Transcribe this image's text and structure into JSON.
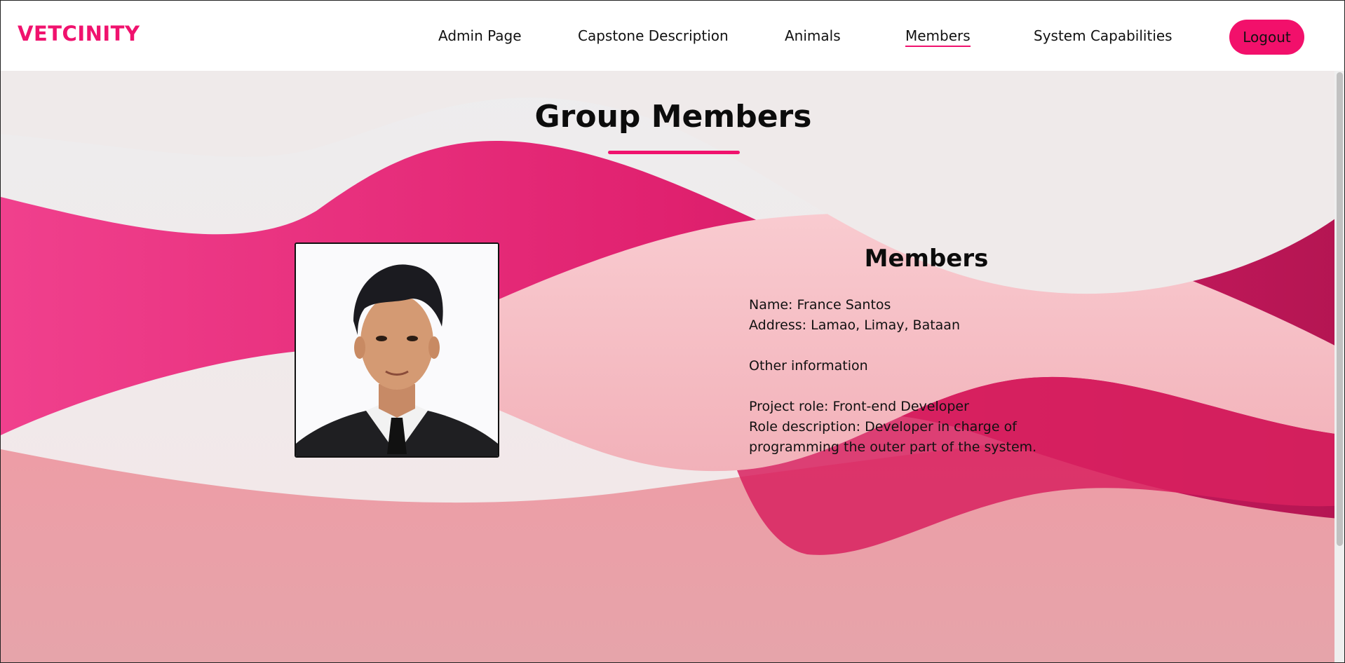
{
  "header": {
    "logo": "VETCINITY",
    "nav": [
      {
        "label": "Admin Page"
      },
      {
        "label": "Capstone Description"
      },
      {
        "label": "Animals"
      },
      {
        "label": "Members"
      },
      {
        "label": "System Capabilities"
      }
    ],
    "active_nav": "Members",
    "logout_label": "Logout"
  },
  "main": {
    "title": "Group Members",
    "member_heading": "Members",
    "member": {
      "name_line": "Name: France Santos",
      "address_line": "Address: Lamao, Limay, Bataan",
      "other_info": "Other information",
      "role_line": "Project role: Front-end Developer",
      "role_desc_line1": "Role description: Developer in charge of",
      "role_desc_line2": "programming the outer part of the system."
    },
    "photo_icon": "member-portrait"
  },
  "colors": {
    "accent": "#f0126e",
    "wave_pink": "#f03a8a",
    "wave_light": "#f8c3c8"
  }
}
